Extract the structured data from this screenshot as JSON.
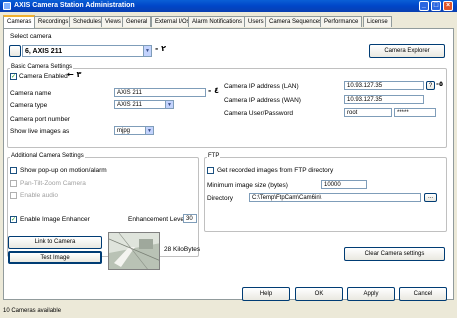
{
  "window": {
    "title": "AXIS Camera Station Administration"
  },
  "tabs": [
    "Cameras",
    "Recordings",
    "Schedules",
    "Views",
    "General",
    "External I/Os",
    "Alarm Notifications",
    "Users",
    "Camera Sequences",
    "Performance",
    "License"
  ],
  "select_camera": {
    "label": "Select camera",
    "value": "6, AXIS 211",
    "explorer_button": "Camera Explorer"
  },
  "basic": {
    "group_label": "Basic Camera Settings",
    "camera_enabled_label": "Camera Enabled",
    "camera_name_label": "Camera name",
    "camera_name_value": "AXIS 211",
    "camera_type_label": "Camera type",
    "camera_type_value": "AXIS 211",
    "port_label": "Camera port number",
    "show_images_label": "Show live images as",
    "show_images_value": "mjpg",
    "ip_lan_label": "Camera IP address (LAN)",
    "ip_lan_value": "10.93.127.35",
    "ip_wan_label": "Camera IP address (WAN)",
    "ip_wan_value": "10.93.127.35",
    "user_pass_label": "Camera User/Password",
    "user_value": "root",
    "pass_value": "*****",
    "help_mark": "?"
  },
  "additional": {
    "group_label": "Additional Camera Settings",
    "popup_label": "Show pop-up on motion/alarm",
    "ptz_label": "Pan-Tilt-Zoom Camera",
    "audio_label": "Enable audio",
    "enhancer_label": "Enable Image Enhancer",
    "enhancement_level_label": "Enhancement Level",
    "enhancement_level_value": "30"
  },
  "ftp": {
    "group_label": "FTP",
    "get_recorded_label": "Get recorded images from FTP directory",
    "min_size_label": "Minimum image size (bytes)",
    "min_size_value": "10000",
    "directory_label": "Directory",
    "directory_value": "C:\\Temp\\FtpCam\\Cam6in\\",
    "browse_label": "..."
  },
  "actions": {
    "link_to_camera": "Link to Camera",
    "test_image": "Test Image",
    "image_size": "28 KiloBytes",
    "clear_camera_settings": "Clear Camera settings"
  },
  "footer_buttons": {
    "help": "Help",
    "ok": "OK",
    "apply": "Apply",
    "cancel": "Cancel"
  },
  "status": {
    "text": "10 Cameras available"
  },
  "annotations": {
    "a2": "٢",
    "a3": "٣",
    "a4": "٤",
    "a5": "٥"
  }
}
